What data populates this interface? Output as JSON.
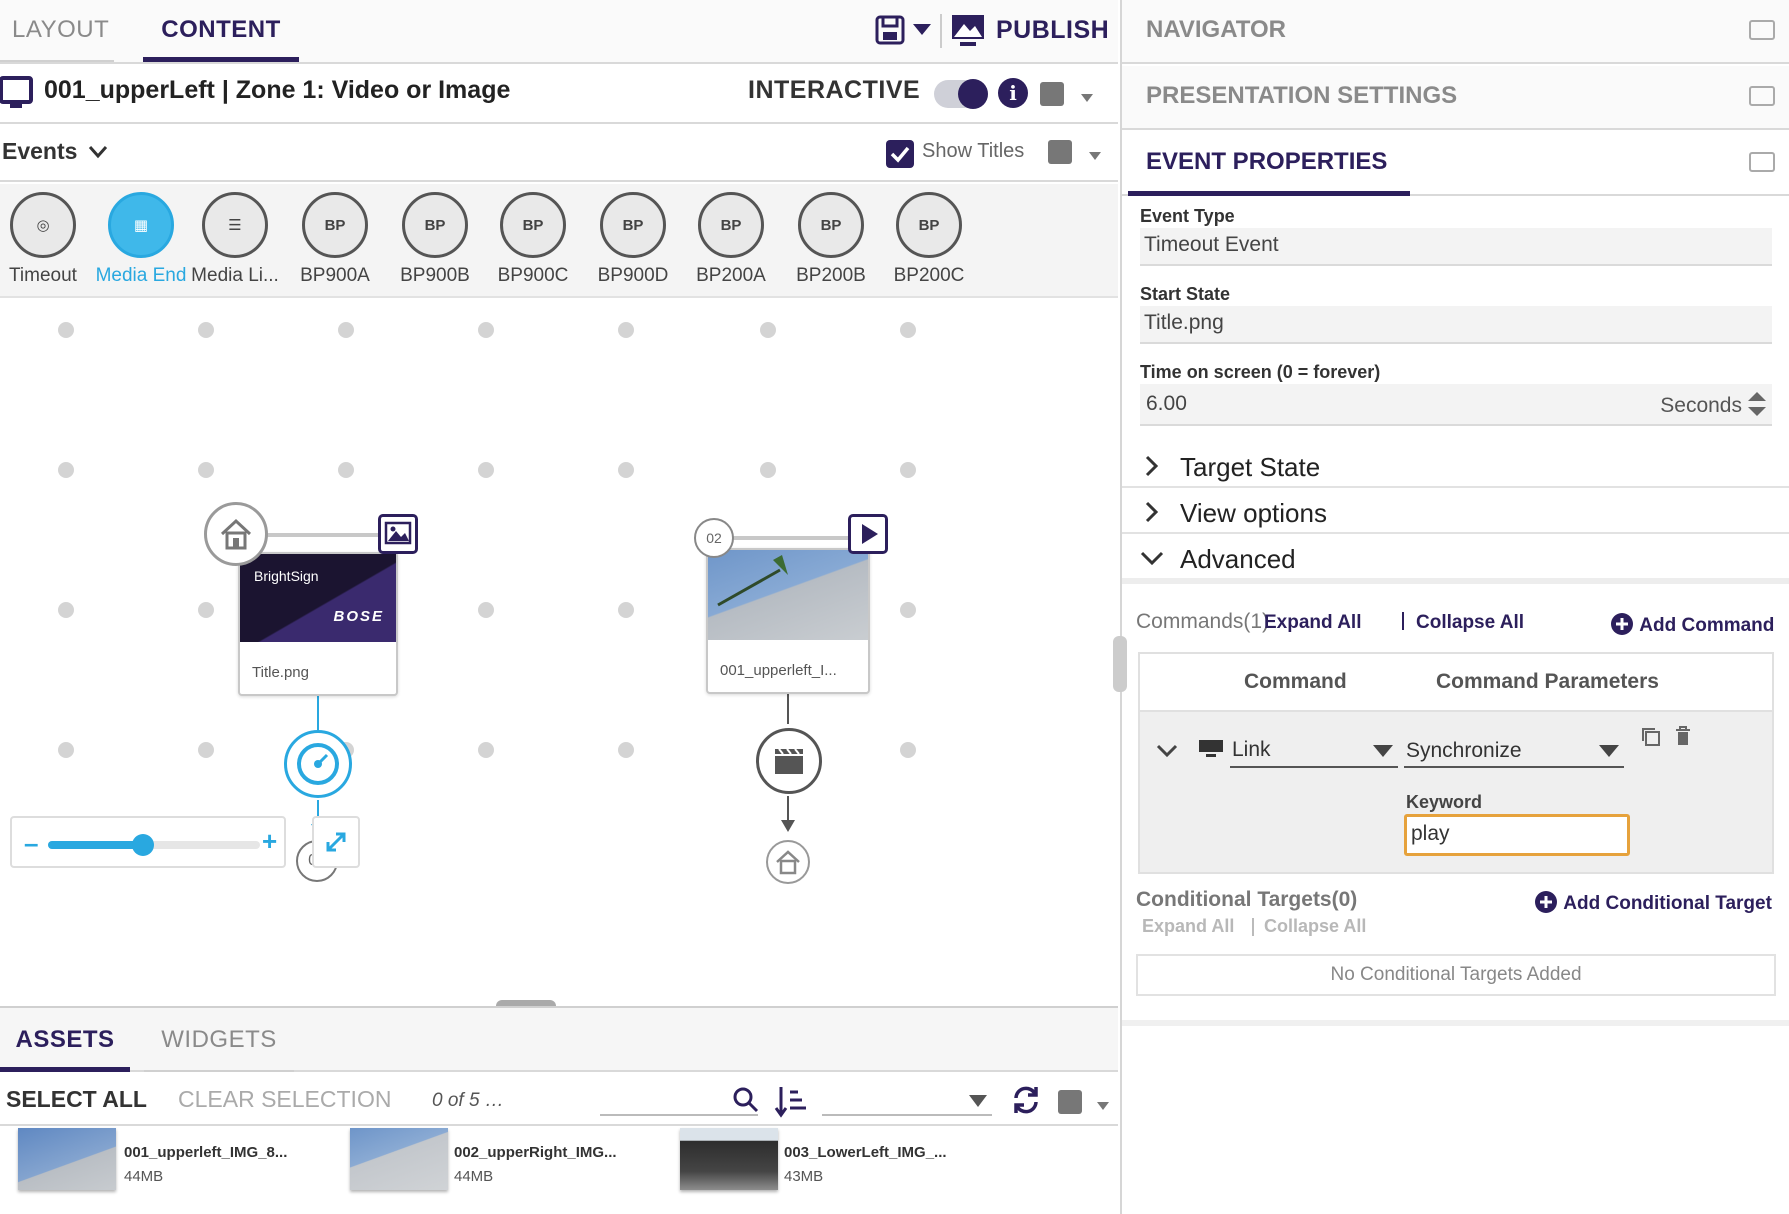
{
  "left_tabs": {
    "layout": "LAYOUT",
    "content": "CONTENT"
  },
  "toolbar": {
    "publish": "PUBLISH"
  },
  "zone": {
    "title": "001_upperLeft | Zone 1: Video or Image",
    "mode_label": "INTERACTIVE"
  },
  "events_bar": {
    "events_label": "Events",
    "show_titles": "Show Titles",
    "show_titles_checked": true
  },
  "palette": [
    {
      "label": "Timeout",
      "icon": "timeout-icon",
      "glyph": "◎",
      "active": false
    },
    {
      "label": "Media End",
      "icon": "media-end-icon",
      "glyph": "▦",
      "active": true
    },
    {
      "label": "Media Li...",
      "icon": "media-list-icon",
      "glyph": "☰",
      "active": false
    },
    {
      "label": "BP900A",
      "icon": "bp900a-icon",
      "glyph": "BP",
      "active": false
    },
    {
      "label": "BP900B",
      "icon": "bp900b-icon",
      "glyph": "BP",
      "active": false
    },
    {
      "label": "BP900C",
      "icon": "bp900c-icon",
      "glyph": "BP",
      "active": false
    },
    {
      "label": "BP900D",
      "icon": "bp900d-icon",
      "glyph": "BP",
      "active": false
    },
    {
      "label": "BP200A",
      "icon": "bp200a-icon",
      "glyph": "BP",
      "active": false
    },
    {
      "label": "BP200B",
      "icon": "bp200b-icon",
      "glyph": "BP",
      "active": false
    },
    {
      "label": "BP200C",
      "icon": "bp200c-icon",
      "glyph": "BP",
      "active": false
    }
  ],
  "states": {
    "state1": {
      "caption": "Title.png",
      "brand_text": "BrightSign",
      "logo_text": "BOSE",
      "next_badge": "02"
    },
    "state2": {
      "badge": "02",
      "caption": "001_upperleft_I..."
    }
  },
  "zoom": {
    "minus": "–",
    "plus": "+",
    "level": 0.45
  },
  "bottom_tabs": {
    "assets": "ASSETS",
    "widgets": "WIDGETS"
  },
  "asset_bar": {
    "select_all": "SELECT ALL",
    "clear_selection": "CLEAR SELECTION",
    "count": "0 of 5 …"
  },
  "assets": [
    {
      "name": "001_upperleft_IMG_8...",
      "size": "44MB"
    },
    {
      "name": "002_upperRight_IMG...",
      "size": "44MB"
    },
    {
      "name": "003_LowerLeft_IMG_...",
      "size": "43MB"
    }
  ],
  "right": {
    "navigator": "NAVIGATOR",
    "presentation_settings": "PRESENTATION SETTINGS",
    "event_properties": "EVENT PROPERTIES",
    "event_type_label": "Event Type",
    "event_type_value": "Timeout Event",
    "start_state_label": "Start State",
    "start_state_value": "Title.png",
    "time_label": "Time on screen (0 = forever)",
    "time_value": "6.00",
    "time_unit": "Seconds",
    "target_state": "Target State",
    "view_options": "View options",
    "advanced": "Advanced",
    "commands_label": "Commands(1)",
    "expand_all": "Expand All",
    "collapse_all": "Collapse All",
    "add_command": "Add Command",
    "col_command": "Command",
    "col_params": "Command Parameters",
    "cmd_type": "Link",
    "cmd_param": "Synchronize",
    "keyword_label": "Keyword",
    "keyword_value": "play",
    "cond_label": "Conditional Targets(0)",
    "cond_expand": "Expand All",
    "cond_collapse": "Collapse All",
    "add_cond": "Add Conditional Target",
    "no_cond": "No Conditional Targets Added"
  },
  "colors": {
    "brand_purple": "#2c1f5c",
    "accent_blue": "#29a8e0",
    "keyword_border": "#e6a23c"
  }
}
